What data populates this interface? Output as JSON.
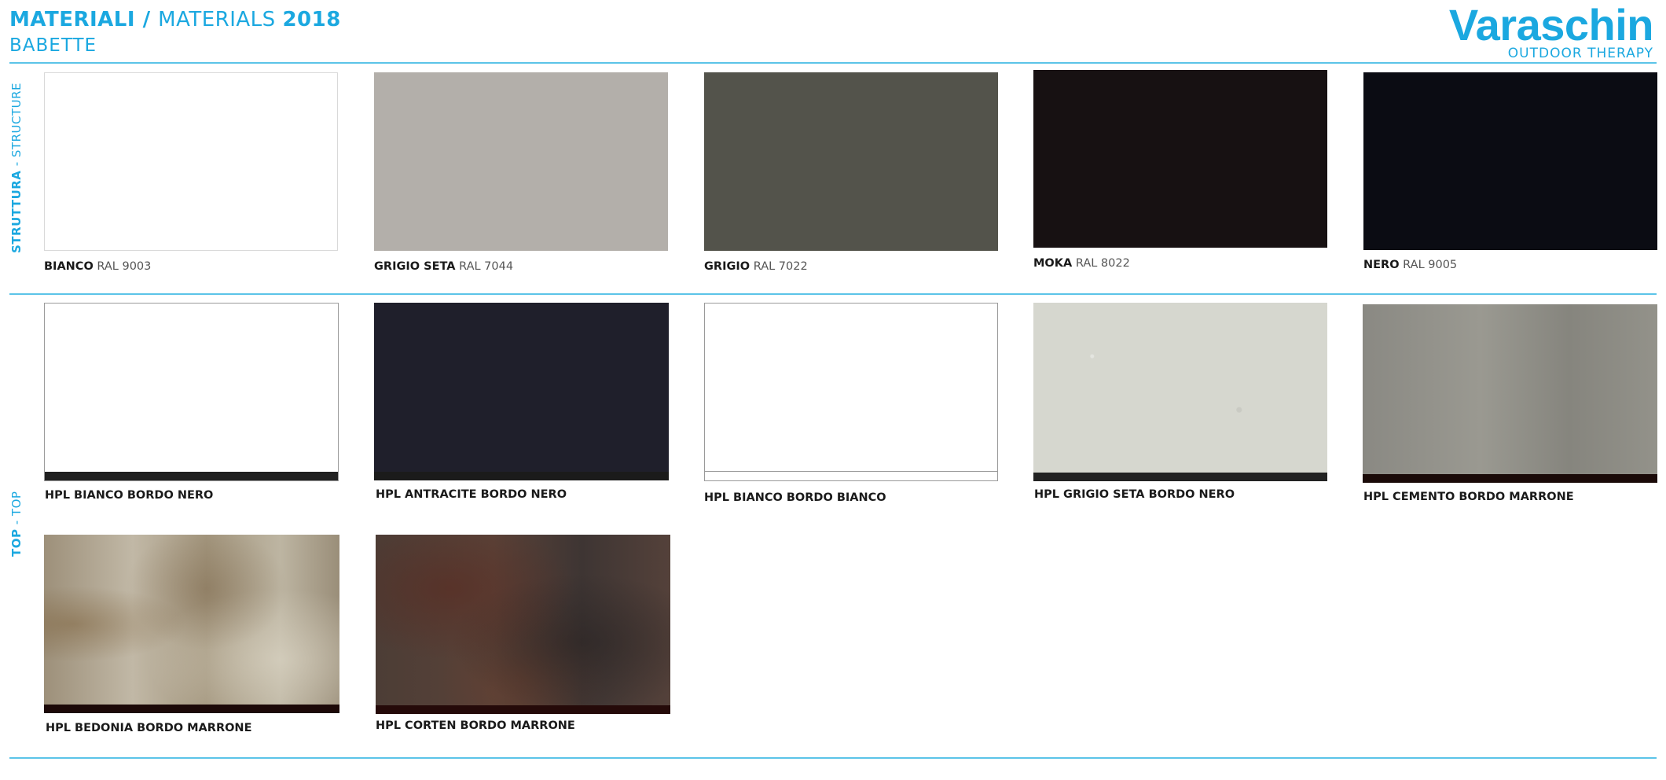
{
  "header": {
    "title_bold1": "MATERIALI",
    "title_sep": " / ",
    "title_thin": "MATERIALS ",
    "title_bold2": "2018",
    "subtitle": "BABETTE"
  },
  "logo": {
    "brand": "Varaschin",
    "tagline": "OUTDOOR THERAPY"
  },
  "sections": {
    "structure": {
      "label_bold": "STRUTTURA",
      "label_rest": " - STRUCTURE"
    },
    "top": {
      "label_bold": "TOP",
      "label_rest": " - TOP"
    }
  },
  "structure_swatches": [
    {
      "name": "BIANCO",
      "code": "RAL 9003",
      "color": "#ffffff"
    },
    {
      "name": "GRIGIO SETA",
      "code": "RAL 7044",
      "color": "#b3afaa"
    },
    {
      "name": "GRIGIO",
      "code": "RAL 7022",
      "color": "#53534b"
    },
    {
      "name": "MOKA",
      "code": "RAL 8022",
      "color": "#171112"
    },
    {
      "name": "NERO",
      "code": "RAL 9005",
      "color": "#0b0c13"
    }
  ],
  "top_swatches": [
    {
      "name": "HPL BIANCO BORDO NERO",
      "color": "#ffffff",
      "edge_color": "#202020"
    },
    {
      "name": "HPL ANTRACITE  BORDO NERO",
      "color": "#1f1f2b",
      "edge_color": "#1b1b1b"
    },
    {
      "name": "HPL BIANCO BORDO BIANCO",
      "color": "#ffffff",
      "edge_color": "#ffffff"
    },
    {
      "name": "HPL GRIGIO SETA  BORDO NERO",
      "color": "#d6d7cf",
      "edge_color": "#222222"
    },
    {
      "name": "HPL CEMENTO BORDO MARRONE",
      "color": "#8e8d86",
      "edge_color": "#1a0a08"
    },
    {
      "name": "HPL BEDONIA BORDO MARRONE",
      "color": "#a59a86",
      "edge_color": "#1c0908"
    },
    {
      "name": "HPL CORTEN BORDO MARRONE",
      "color": "#4a3a33",
      "edge_color": "#250a09"
    }
  ]
}
